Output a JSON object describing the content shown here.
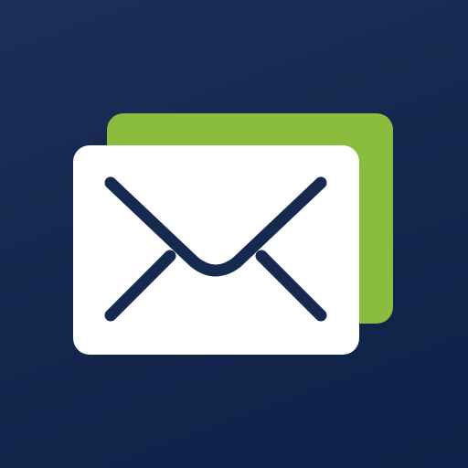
{
  "icon": {
    "name": "mail-app-icon",
    "glyph": "envelope-icon",
    "colors": {
      "background": "#16294f",
      "accent_card": "#8abd3e",
      "front_card": "#ffffff",
      "envelope_stroke": "#16294f"
    }
  }
}
